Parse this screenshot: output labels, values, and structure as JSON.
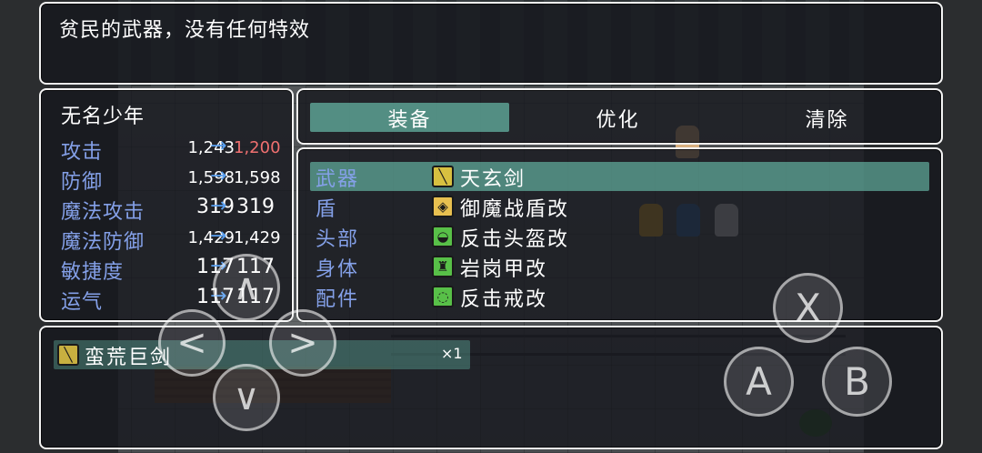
{
  "help": {
    "text": "贫民的武器，没有任何特效"
  },
  "status": {
    "actor_name": "无名少年",
    "arrow": "→",
    "params": [
      {
        "label": "攻击",
        "old": "1,243",
        "new": "1,200",
        "decreased": true
      },
      {
        "label": "防御",
        "old": "1,598",
        "new": "1,598",
        "decreased": false
      },
      {
        "label": "魔法攻击",
        "old": "319",
        "new": "319",
        "decreased": false
      },
      {
        "label": "魔法防御",
        "old": "1,429",
        "new": "1,429",
        "decreased": false
      },
      {
        "label": "敏捷度",
        "old": "117",
        "new": "117",
        "decreased": false
      },
      {
        "label": "运气",
        "old": "117",
        "new": "117",
        "decreased": false
      }
    ]
  },
  "commands": {
    "equip": "装备",
    "optimize": "优化",
    "clear": "清除"
  },
  "slots": [
    {
      "name": "武器",
      "item": "天玄剑",
      "icon": "sword-icon",
      "icon_color": "#d8c040",
      "glyph": "╲"
    },
    {
      "name": "盾",
      "item": "御魔战盾改",
      "icon": "shield-icon",
      "icon_color": "#e8c050",
      "glyph": "◈"
    },
    {
      "name": "头部",
      "item": "反击头盔改",
      "icon": "helmet-icon",
      "icon_color": "#58c048",
      "glyph": "◒"
    },
    {
      "name": "身体",
      "item": "岩岗甲改",
      "icon": "armor-icon",
      "icon_color": "#58c048",
      "glyph": "♜"
    },
    {
      "name": "配件",
      "item": "反击戒改",
      "icon": "ring-icon",
      "icon_color": "#58c048",
      "glyph": "◌"
    }
  ],
  "items": [
    {
      "name": "蛮荒巨剑",
      "count": "×1",
      "icon": "sword-icon",
      "icon_color": "#c8b040",
      "glyph": "╲"
    }
  ],
  "controls": {
    "up": "∧",
    "down": "∨",
    "left": "<",
    "right": ">",
    "x": "X",
    "a": "A",
    "b": "B"
  }
}
